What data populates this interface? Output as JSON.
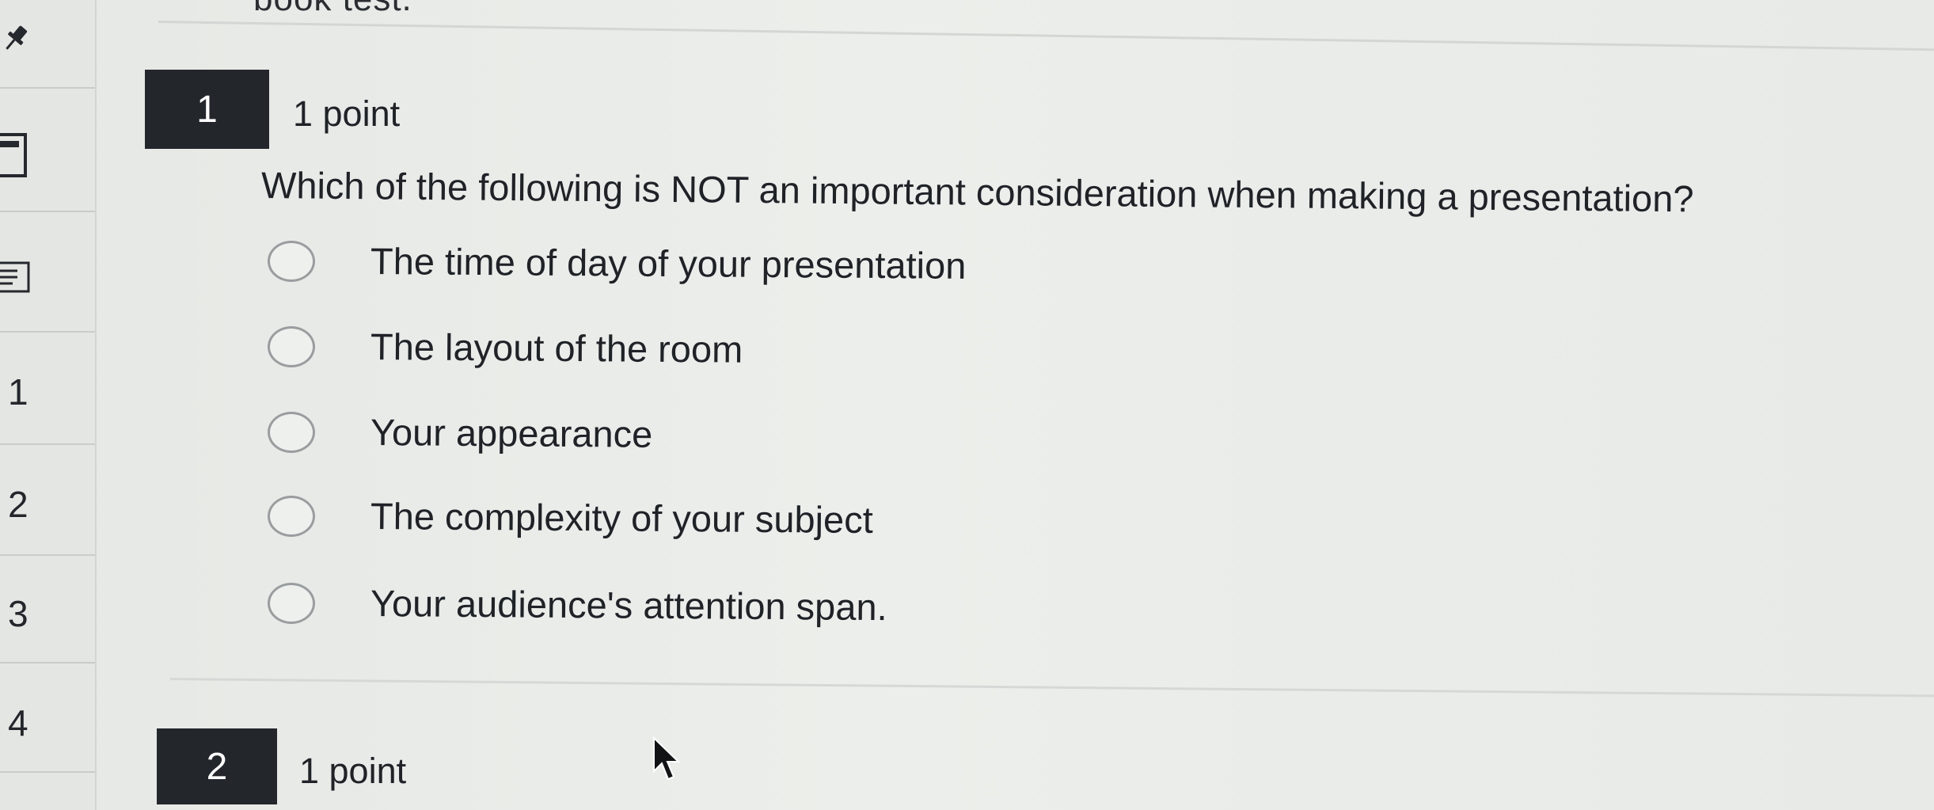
{
  "header": {
    "cut_off_text": "book test."
  },
  "sidebar": {
    "icons": [
      "pin-icon",
      "calculator-icon",
      "notes-icon"
    ],
    "question_links": [
      "1",
      "2",
      "3",
      "4"
    ]
  },
  "questions": [
    {
      "number": "1",
      "points": "1 point",
      "text": "Which of the following is NOT an important consideration when making a presentation?",
      "options": [
        "The time of day of your presentation",
        "The layout of the room",
        "Your appearance",
        "The complexity of your subject",
        "Your audience's attention span."
      ],
      "selected": null
    },
    {
      "number": "2",
      "points": "1 point"
    }
  ],
  "colors": {
    "badge_bg": "#23272c",
    "badge_text": "#ffffff",
    "radio_border": "#9a9d9f",
    "page_bg": "#e9ebe8"
  }
}
